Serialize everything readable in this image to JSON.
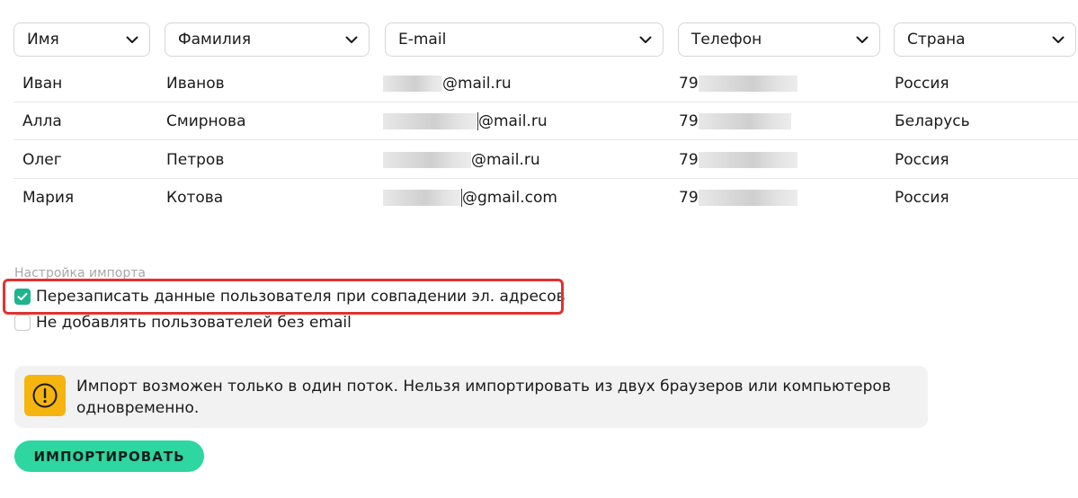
{
  "columns": [
    {
      "label": "Имя"
    },
    {
      "label": "Фамилия"
    },
    {
      "label": "E-mail"
    },
    {
      "label": "Телефон"
    },
    {
      "label": "Страна"
    }
  ],
  "rows": [
    {
      "first_name": "Иван",
      "last_name": "Иванов",
      "email_suffix": "@mail.ru",
      "phone_prefix": "79",
      "country": "Россия"
    },
    {
      "first_name": "Алла",
      "last_name": "Смирнова",
      "email_suffix": "@mail.ru",
      "phone_prefix": "79",
      "country": "Беларусь"
    },
    {
      "first_name": "Олег",
      "last_name": "Петров",
      "email_suffix": "@mail.ru",
      "phone_prefix": "79",
      "country": "Россия"
    },
    {
      "first_name": "Мария",
      "last_name": "Котова",
      "email_suffix": "@gmail.com",
      "phone_prefix": "79",
      "country": "Россия"
    }
  ],
  "settings": {
    "label": "Настройка импорта",
    "options": [
      {
        "label": "Перезаписать данные пользователя при совпадении эл. адресов",
        "checked": true
      },
      {
        "label": "Не добавлять пользователей без email",
        "checked": false
      }
    ]
  },
  "notice": {
    "icon": "warning-icon",
    "text": "Импорт возможен только в один поток. Нельзя импортировать из двух браузеров или компьютеров одновременно."
  },
  "import_button": {
    "label": "ИМПОРТИРОВАТЬ"
  },
  "colors": {
    "accent": "#2ed6a0",
    "checkbox": "#1fb58a",
    "warning": "#f6b40e",
    "highlight": "#e0332f"
  }
}
